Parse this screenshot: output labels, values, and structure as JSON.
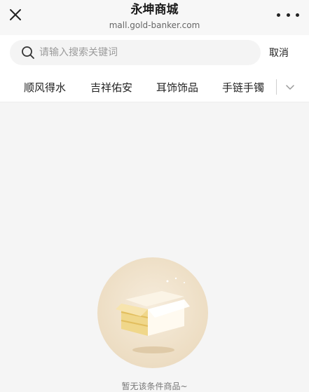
{
  "header": {
    "title": "永坤商城",
    "subtitle": "mall.gold-banker.com",
    "close_icon": "close-icon",
    "more_icon": "more-dots-icon"
  },
  "search": {
    "placeholder": "请输入搜索关键词",
    "value": "",
    "cancel_label": "取消",
    "icon": "search-icon"
  },
  "tabs": [
    {
      "label": "顺风得水"
    },
    {
      "label": "吉祥佑安"
    },
    {
      "label": "耳饰饰品"
    },
    {
      "label": "手链手镯"
    }
  ],
  "tabs_expand_icon": "chevron-down-icon",
  "empty_state": {
    "message": "暂无该条件商品~",
    "icon": "empty-box-icon"
  },
  "colors": {
    "accent_gold": "#e8d6b9",
    "background": "#f5f5f5"
  }
}
